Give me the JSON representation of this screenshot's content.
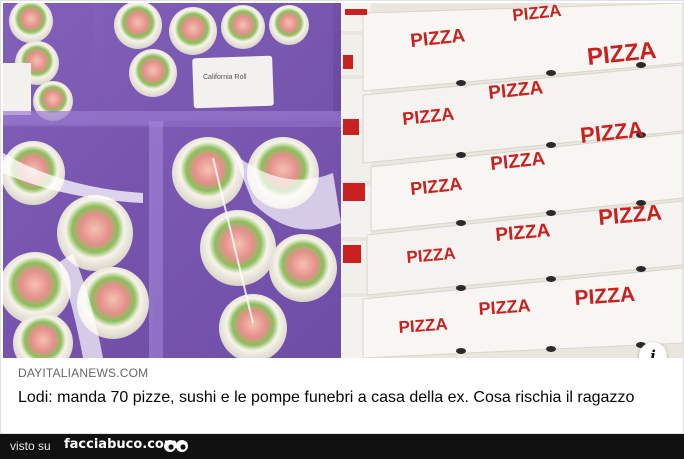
{
  "post": {
    "image_alt": "",
    "info_icon_label": "i",
    "source": "DAYITALIANEWS.COM",
    "headline": "Lodi: manda 70 pizze, sushi e le pompe funebri a casa della ex. Cosa rischia il ragazzo"
  },
  "image_text": {
    "pizza_label": "PIZZA",
    "sushi_tag": "California Roll"
  },
  "footer": {
    "seen_on": "visto su",
    "brand": "facciabuco.com",
    "logo_icon": "eyes-icon"
  },
  "colors": {
    "pizza_red": "#c8211f",
    "sushi_tray": "#6b49a3",
    "footer_bg": "#111111"
  }
}
